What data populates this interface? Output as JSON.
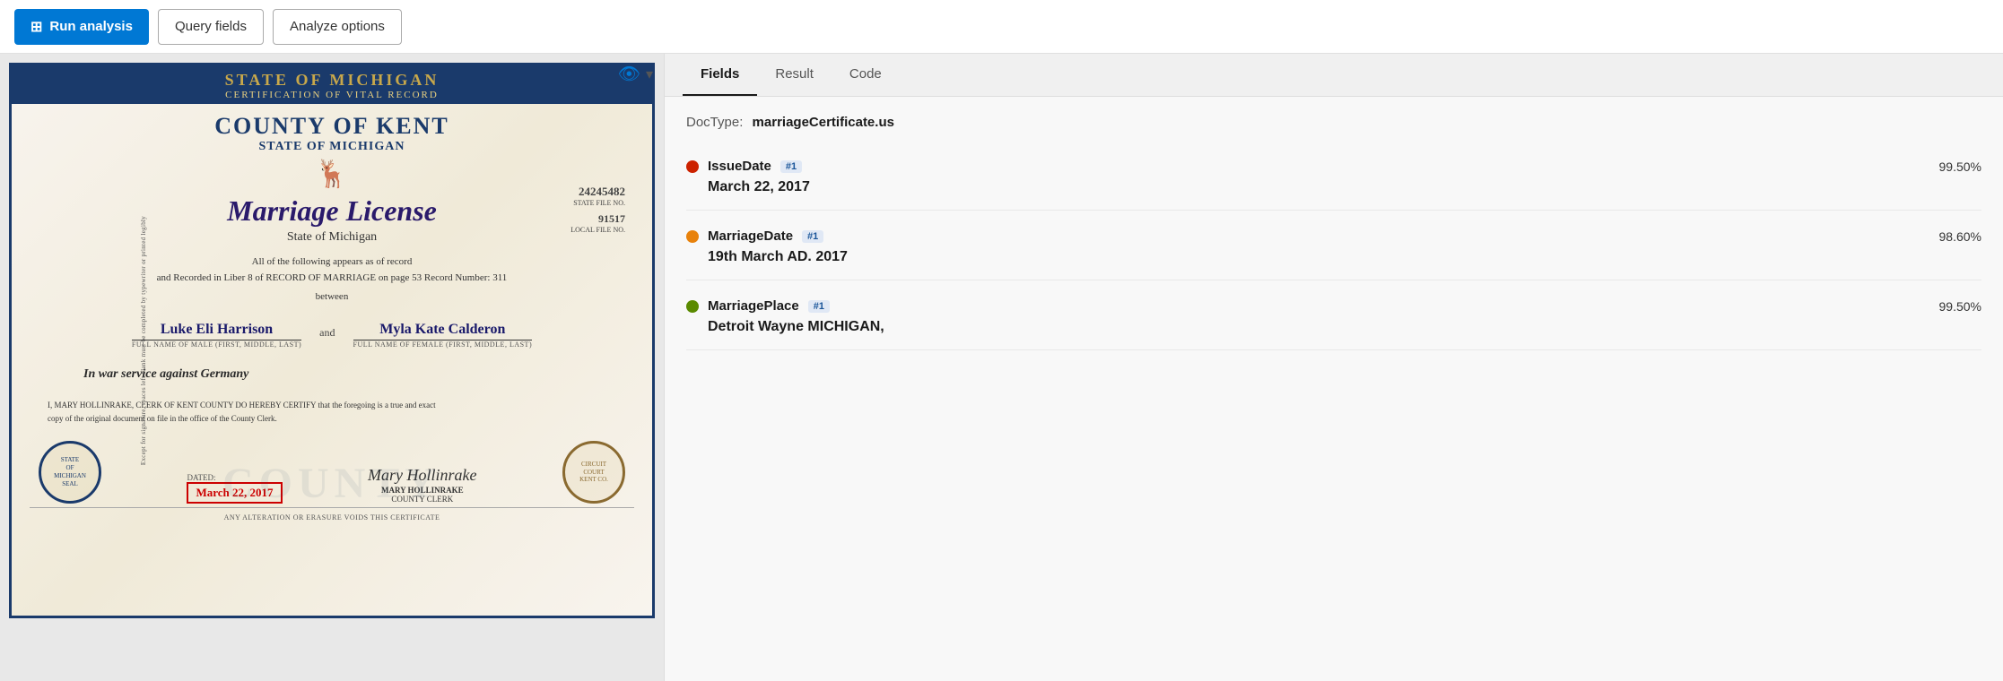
{
  "toolbar": {
    "run_label": "Run analysis",
    "query_fields_label": "Query fields",
    "analyze_options_label": "Analyze options"
  },
  "document": {
    "cert_header_title": "STATE OF MICHIGAN",
    "cert_header_sub": "CERTIFICATION OF VITAL RECORD",
    "cert_county": "COUNTY OF KENT",
    "cert_state_line": "STATE OF MICHIGAN",
    "cert_file_no": "24245482",
    "cert_file_no_label": "STATE FILE NO.",
    "cert_local_file": "91517",
    "cert_local_file_label": "LOCAL FILE NO.",
    "cert_main_title": "Marriage License",
    "cert_state": "State of Michigan",
    "cert_body_line1": "All of the following appears as of record",
    "cert_body_line2": "and Recorded in Liber  8  of RECORD OF MARRIAGE on page  53  Record Number:  311",
    "cert_between": "between",
    "cert_and": "and",
    "cert_name_male": "Luke Eli Harrison",
    "cert_name_male_label": "FULL NAME OF MALE (FIRST, MIDDLE, LAST)",
    "cert_name_female": "Myla Kate Calderon",
    "cert_name_female_label": "FULL NAME OF FEMALE (FIRST, MIDDLE, LAST)",
    "cert_watermark": "COUNTY",
    "cert_war_text": "In war service against Germany",
    "cert_clerk_text": "I, MARY HOLLINRAKE, CLERK OF KENT COUNTY DO HEREBY CERTIFY that the foregoing is a true and exact",
    "cert_clerk_text2": "copy of the original document on file in the office of the County Clerk.",
    "cert_dated_label": "DATED:",
    "cert_date_value": "March 22, 2017",
    "cert_signer": "MARY HOLLINRAKE",
    "cert_signer_title": "COUNTY CLERK",
    "cert_bottom_notice": "ANY ALTERATION OR ERASURE VOIDS THIS CERTIFICATE",
    "cert_left_text": "Except for signature, spaces left blank must be completed by typewriter or printed legibly"
  },
  "panel": {
    "tab_fields": "Fields",
    "tab_result": "Result",
    "tab_code": "Code",
    "active_tab": "Fields",
    "doctype_label": "DocType:",
    "doctype_value": "marriageCertificate.us",
    "fields": [
      {
        "name": "IssueDate",
        "badge": "#1",
        "dot_color": "#cc2200",
        "confidence": "99.50%",
        "value": "March 22, 2017"
      },
      {
        "name": "MarriageDate",
        "badge": "#1",
        "dot_color": "#e8820c",
        "confidence": "98.60%",
        "value": "19th March AD. 2017"
      },
      {
        "name": "MarriagePlace",
        "badge": "#1",
        "dot_color": "#5a8a00",
        "confidence": "99.50%",
        "value": "Detroit Wayne MICHIGAN,"
      }
    ]
  }
}
